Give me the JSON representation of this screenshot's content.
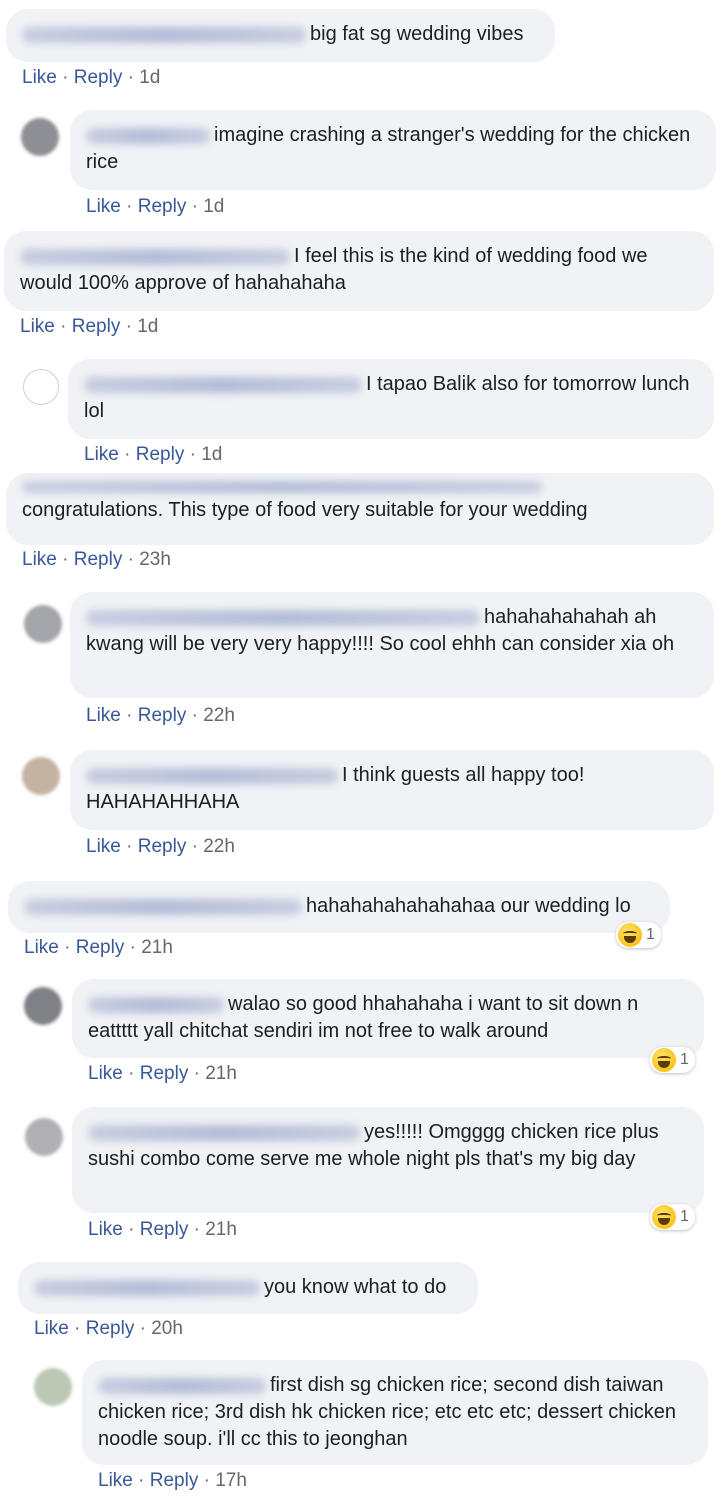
{
  "comments": [
    {
      "text": "big fat sg wedding vibes",
      "like": "Like",
      "reply": "Reply",
      "time": "1d"
    },
    {
      "text": "imagine crashing a stranger's wedding for the chicken rice",
      "like": "Like",
      "reply": "Reply",
      "time": "1d"
    },
    {
      "text": "I feel this is the kind of wedding food we would 100% approve of hahahahaha",
      "like": "Like",
      "reply": "Reply",
      "time": "1d"
    },
    {
      "text": "I tapao Balik also for tomorrow lunch lol",
      "like": "Like",
      "reply": "Reply",
      "time": "1d"
    },
    {
      "text": "congratulations. This type of food very suitable for your wedding",
      "like": "Like",
      "reply": "Reply",
      "time": "23h"
    },
    {
      "text": "hahahahahahah ah kwang will be very very happy!!!! So cool ehhh can consider xia oh",
      "like": "Like",
      "reply": "Reply",
      "time": "22h"
    },
    {
      "text": "I think guests all happy too! HAHAHAHHAHA",
      "like": "Like",
      "reply": "Reply",
      "time": "22h"
    },
    {
      "text": "hahahahahahahahaa our wedding lo",
      "like": "Like",
      "reply": "Reply",
      "time": "21h",
      "reaction_count": "1"
    },
    {
      "text": "walao so good hhahahaha i want to sit down n eattttt yall chitchat sendiri im not free to walk around",
      "like": "Like",
      "reply": "Reply",
      "time": "21h",
      "reaction_count": "1"
    },
    {
      "text": "yes!!!!! Omgggg chicken rice plus sushi combo come serve me whole night pls that's my big day",
      "like": "Like",
      "reply": "Reply",
      "time": "21h",
      "reaction_count": "1"
    },
    {
      "text": "you know what to do",
      "like": "Like",
      "reply": "Reply",
      "time": "20h"
    },
    {
      "text": "first dish sg chicken rice; second dish taiwan chicken rice; 3rd dish hk chicken rice; etc etc etc; dessert chicken noodle soup. i'll cc this to jeonghan",
      "like": "Like",
      "reply": "Reply",
      "time": "17h"
    }
  ],
  "reaction_icon": "haha-emoji-icon",
  "colors": {
    "bubble": "#f0f2f5",
    "link": "#385898",
    "meta": "#65676b"
  }
}
